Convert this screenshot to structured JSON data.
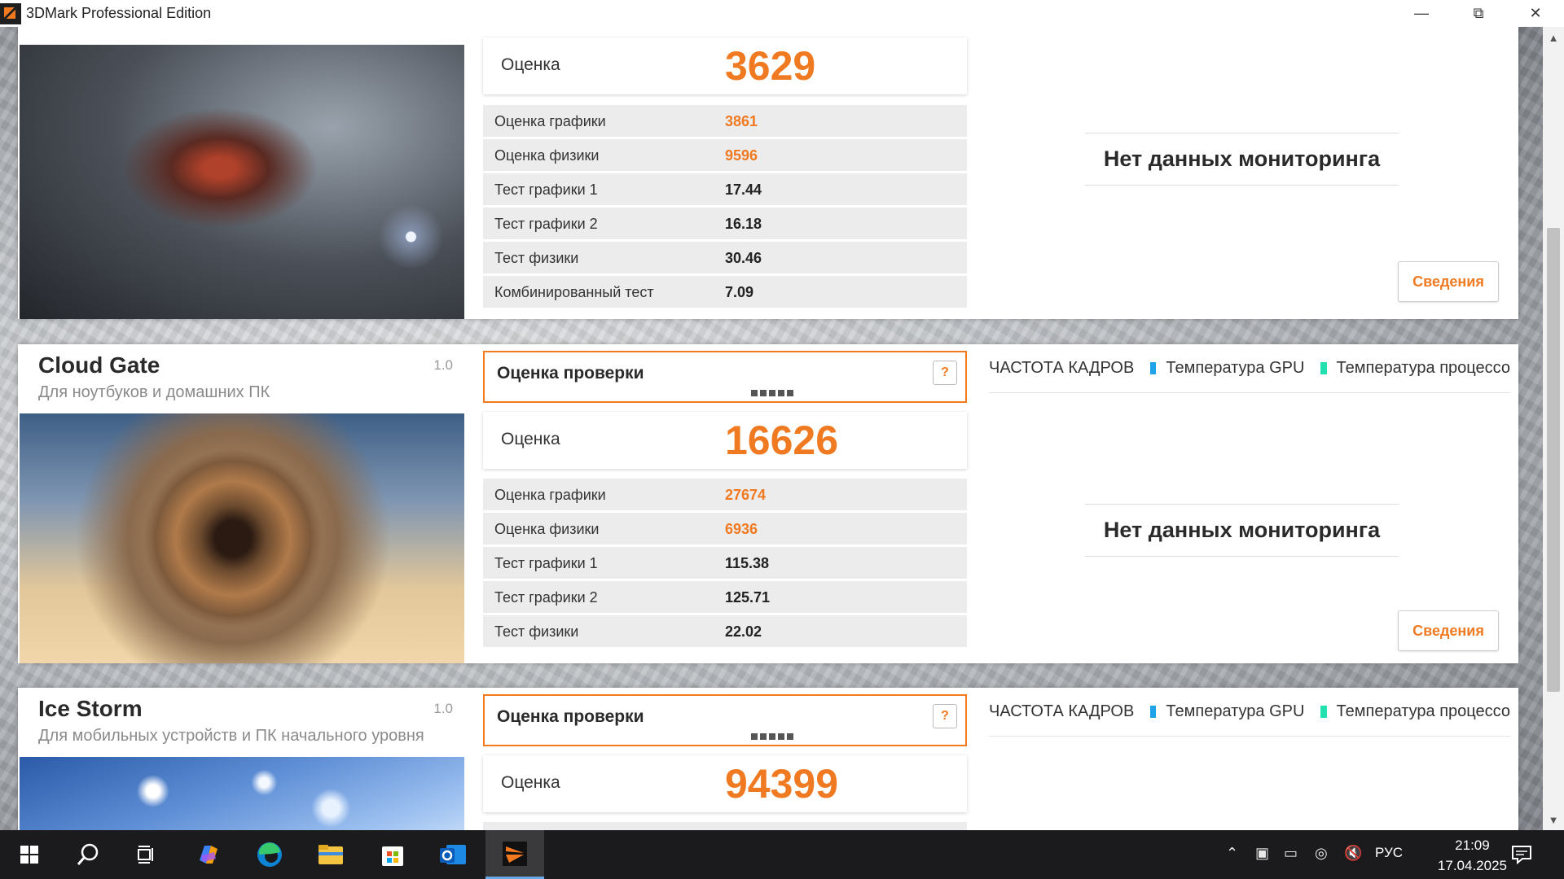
{
  "window": {
    "title": "3DMark Professional Edition"
  },
  "panels": [
    {
      "id": "fire-strike",
      "score_label": "Оценка",
      "score": "3629",
      "rows": [
        {
          "label": "Оценка графики",
          "value": "3861",
          "accent": true
        },
        {
          "label": "Оценка физики",
          "value": "9596",
          "accent": true
        },
        {
          "label": "Тест графики 1",
          "value": "17.44",
          "accent": false
        },
        {
          "label": "Тест графики 2",
          "value": "16.18",
          "accent": false
        },
        {
          "label": "Тест физики",
          "value": "30.46",
          "accent": false
        },
        {
          "label": "Комбинированный тест",
          "value": "7.09",
          "accent": false
        }
      ],
      "monitor_text": "Нет данных мониторинга",
      "details_label": "Сведения"
    },
    {
      "id": "cloud-gate",
      "name": "Cloud Gate",
      "subtitle": "Для ноутбуков и домашних ПК",
      "version": "1.0",
      "check_label": "Оценка проверки",
      "help": "?",
      "score_label": "Оценка",
      "score": "16626",
      "rows": [
        {
          "label": "Оценка графики",
          "value": "27674",
          "accent": true
        },
        {
          "label": "Оценка физики",
          "value": "6936",
          "accent": true
        },
        {
          "label": "Тест графики 1",
          "value": "115.38",
          "accent": false
        },
        {
          "label": "Тест графики 2",
          "value": "125.71",
          "accent": false
        },
        {
          "label": "Тест физики",
          "value": "22.02",
          "accent": false
        }
      ],
      "legend": [
        "ЧАСТОТА КАДРОВ",
        "Температура GPU",
        "Температура процессо"
      ],
      "monitor_text": "Нет данных мониторинга",
      "details_label": "Сведения"
    },
    {
      "id": "ice-storm",
      "name": "Ice Storm",
      "subtitle": "Для мобильных устройств и ПК начального уровня",
      "version": "1.0",
      "check_label": "Оценка проверки",
      "help": "?",
      "score_label": "Оценка",
      "score": "94399",
      "legend": [
        "ЧАСТОТА КАДРОВ",
        "Температура GPU",
        "Температура процессо"
      ]
    }
  ],
  "colors": {
    "accent": "#f07a22",
    "legend_gpu": "#1fa3e8",
    "legend_cpu": "#22e0b0"
  },
  "taskbar": {
    "apps": [
      "windows-icon",
      "search-icon",
      "task-view-icon",
      "copilot-icon",
      "edge-icon",
      "file-explorer-icon",
      "store-icon",
      "outlook-icon",
      "3dmark-icon"
    ],
    "lang": "РУС",
    "time": "21:09",
    "date": "17.04.2025"
  }
}
